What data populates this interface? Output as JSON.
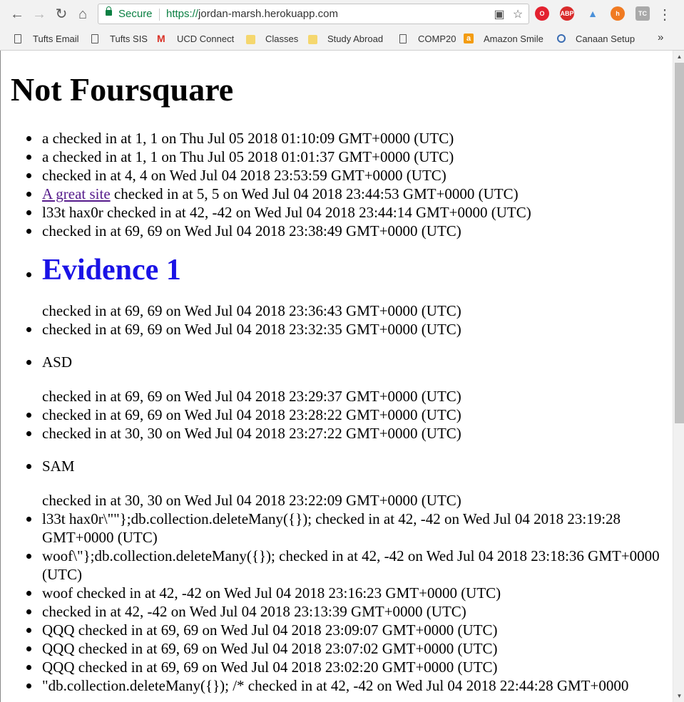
{
  "browser": {
    "secure_label": "Secure",
    "url_scheme": "https://",
    "url_host": "jordan-marsh.herokuapp.com",
    "more_bookmarks": "»",
    "bookmarks": [
      {
        "label": "Tufts Email",
        "icon": "page-icon"
      },
      {
        "label": "Tufts SIS",
        "icon": "page-icon"
      },
      {
        "label": "UCD Connect",
        "icon": "gmail-icon"
      },
      {
        "label": "Classes",
        "icon": "folder-icon"
      },
      {
        "label": "Study Abroad",
        "icon": "folder-icon"
      },
      {
        "label": "COMP20",
        "icon": "page-icon"
      },
      {
        "label": "Amazon Smile",
        "icon": "amazon-icon"
      },
      {
        "label": "Canaan Setup",
        "icon": "canaan-icon"
      }
    ],
    "extensions": [
      {
        "name": "opera-icon",
        "text": "O",
        "color": "#e3212f"
      },
      {
        "name": "adblock-plus-icon",
        "text": "ABP",
        "color": "#d92b2b"
      },
      {
        "name": "tracker-icon",
        "text": "▲",
        "color": "#4a90d9"
      },
      {
        "name": "honey-icon",
        "text": "h",
        "color": "#f07a21"
      },
      {
        "name": "tc-icon",
        "text": "TC",
        "color": "#a9a9a9"
      }
    ]
  },
  "page": {
    "title": "Not Foursquare",
    "link_text": "A great site",
    "checkins": [
      {
        "text": "a checked in at 1, 1 on Thu Jul 05 2018 01:10:09 GMT+0000 (UTC)"
      },
      {
        "text": "a checked in at 1, 1 on Thu Jul 05 2018 01:01:37 GMT+0000 (UTC)"
      },
      {
        "text": "checked in at 4, 4 on Wed Jul 04 2018 23:53:59 GMT+0000 (UTC)"
      },
      {
        "text": " checked in at 5, 5 on Wed Jul 04 2018 23:44:53 GMT+0000 (UTC)"
      },
      {
        "text": "l33t hax0r checked in at 42, -42 on Wed Jul 04 2018 23:44:14 GMT+0000 (UTC)"
      },
      {
        "text": "checked in at 69, 69 on Wed Jul 04 2018 23:38:49 GMT+0000 (UTC)"
      },
      {
        "heading": "Evidence 1",
        "text": "checked in at 69, 69 on Wed Jul 04 2018 23:36:43 GMT+0000 (UTC)"
      },
      {
        "text": "checked in at 69, 69 on Wed Jul 04 2018 23:32:35 GMT+0000 (UTC)"
      },
      {
        "heading": "ASD",
        "text": "checked in at 69, 69 on Wed Jul 04 2018 23:29:37 GMT+0000 (UTC)"
      },
      {
        "text": "checked in at 69, 69 on Wed Jul 04 2018 23:28:22 GMT+0000 (UTC)"
      },
      {
        "text": "checked in at 30, 30 on Wed Jul 04 2018 23:27:22 GMT+0000 (UTC)"
      },
      {
        "heading": "SAM",
        "text": "checked in at 30, 30 on Wed Jul 04 2018 23:22:09 GMT+0000 (UTC)"
      },
      {
        "text": "l33t hax0r\\\"\"};db.collection.deleteMany({}); checked in at 42, -42 on Wed Jul 04 2018 23:19:28 GMT+0000 (UTC)"
      },
      {
        "text": "woof\\\"};db.collection.deleteMany({}); checked in at 42, -42 on Wed Jul 04 2018 23:18:36 GMT+0000 (UTC)"
      },
      {
        "text": "woof checked in at 42, -42 on Wed Jul 04 2018 23:16:23 GMT+0000 (UTC)"
      },
      {
        "text": "checked in at 42, -42 on Wed Jul 04 2018 23:13:39 GMT+0000 (UTC)"
      },
      {
        "text": "QQQ checked in at 69, 69 on Wed Jul 04 2018 23:09:07 GMT+0000 (UTC)"
      },
      {
        "text": "QQQ checked in at 69, 69 on Wed Jul 04 2018 23:07:02 GMT+0000 (UTC)"
      },
      {
        "text": "QQQ checked in at 69, 69 on Wed Jul 04 2018 23:02:20 GMT+0000 (UTC)"
      },
      {
        "text": "\"db.collection.deleteMany({}); /* checked in at 42, -42 on Wed Jul 04 2018 22:44:28 GMT+0000"
      }
    ]
  }
}
